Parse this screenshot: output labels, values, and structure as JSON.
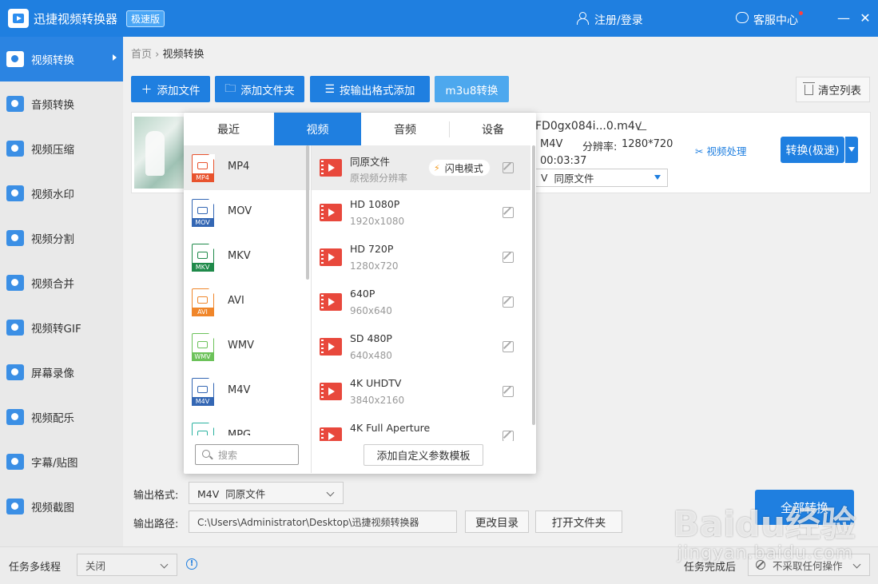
{
  "app": {
    "title": "迅捷视频转换器",
    "badge": "极速版",
    "login": "注册/登录",
    "service": "客服中心"
  },
  "sidebar": {
    "items": [
      {
        "label": "视频转换"
      },
      {
        "label": "音频转换"
      },
      {
        "label": "视频压缩"
      },
      {
        "label": "视频水印"
      },
      {
        "label": "视频分割"
      },
      {
        "label": "视频合并"
      },
      {
        "label": "视频转GIF"
      },
      {
        "label": "屏幕录像"
      },
      {
        "label": "视频配乐"
      },
      {
        "label": "字幕/贴图"
      },
      {
        "label": "视频截图"
      }
    ]
  },
  "breadcrumb": {
    "home": "首页",
    "sep": "›",
    "current": "视频转换"
  },
  "toolbar": {
    "add_file": "添加文件",
    "add_folder": "添加文件夹",
    "add_by_format": "按输出格式添加",
    "m3u8": "m3u8转换",
    "clear": "清空列表"
  },
  "file": {
    "name": "FD0gx084i...0.m4v",
    "format": "M4V",
    "res_label": "分辨率:",
    "resolution": "1280*720",
    "duration": "00:03:37",
    "select_prefix": "V",
    "select_value": "同原文件",
    "video_process": "视频处理",
    "convert": "转换(极速)"
  },
  "panel": {
    "tabs": [
      "最近",
      "视频",
      "音频",
      "设备"
    ],
    "formats": [
      {
        "name": "MP4",
        "color": "#e8532e"
      },
      {
        "name": "MOV",
        "color": "#3467b4"
      },
      {
        "name": "MKV",
        "color": "#1f8a4a"
      },
      {
        "name": "AVI",
        "color": "#f0862a"
      },
      {
        "name": "WMV",
        "color": "#6cc25a"
      },
      {
        "name": "M4V",
        "color": "#3467b4"
      },
      {
        "name": "MPG",
        "color": "#2bb2a0"
      }
    ],
    "qualities": [
      {
        "name": "同原文件",
        "res": "原视频分辨率"
      },
      {
        "name": "HD 1080P",
        "res": "1920x1080"
      },
      {
        "name": "HD 720P",
        "res": "1280x720"
      },
      {
        "name": "640P",
        "res": "960x640"
      },
      {
        "name": "SD 480P",
        "res": "640x480"
      },
      {
        "name": "4K UHDTV",
        "res": "3840x2160"
      },
      {
        "name": "4K Full Aperture",
        "res": ""
      }
    ],
    "flash_mode": "闪电模式",
    "search_placeholder": "搜索",
    "custom_template": "添加自定义参数模板"
  },
  "output": {
    "format_label": "输出格式:",
    "format_value": "M4V  同原文件",
    "path_label": "输出路径:",
    "path_value": "C:\\Users\\Administrator\\Desktop\\迅捷视频转换器",
    "change_dir": "更改目录",
    "open_folder": "打开文件夹",
    "convert_all": "全部转换"
  },
  "status": {
    "multithread_label": "任务多线程",
    "multithread_value": "关闭",
    "done_label": "任务完成后",
    "done_value": "不采取任何操作"
  },
  "watermark": {
    "brand": "Baidu经验",
    "url": "jingyan.baidu.com"
  }
}
